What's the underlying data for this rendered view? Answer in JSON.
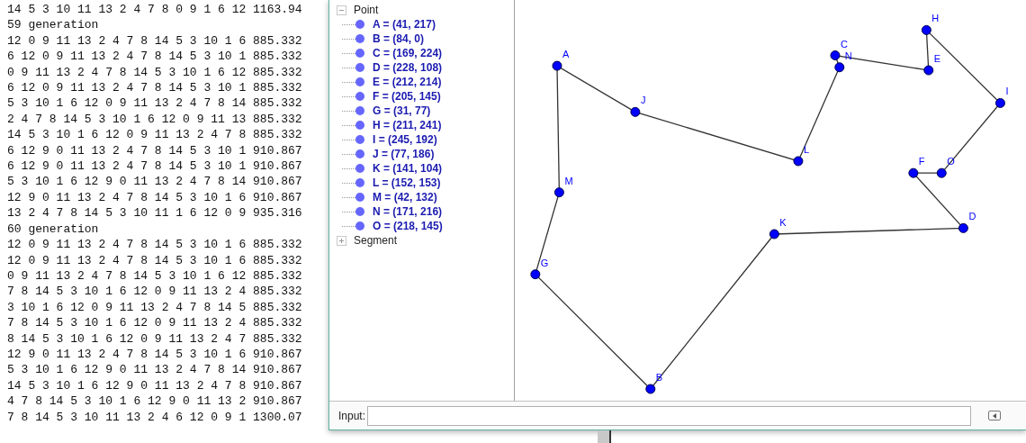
{
  "console": {
    "lines": [
      "14 5 3 10 11 13 2 4 7 8 0 9 1 6 12 1163.94",
      "59 generation",
      "12 0 9 11 13 2 4 7 8 14 5 3 10 1 6 885.332",
      "6 12 0 9 11 13 2 4 7 8 14 5 3 10 1 885.332",
      "0 9 11 13 2 4 7 8 14 5 3 10 1 6 12 885.332",
      "6 12 0 9 11 13 2 4 7 8 14 5 3 10 1 885.332",
      "5 3 10 1 6 12 0 9 11 13 2 4 7 8 14 885.332",
      "2 4 7 8 14 5 3 10 1 6 12 0 9 11 13 885.332",
      "14 5 3 10 1 6 12 0 9 11 13 2 4 7 8 885.332",
      "6 12 9 0 11 13 2 4 7 8 14 5 3 10 1 910.867",
      "6 12 9 0 11 13 2 4 7 8 14 5 3 10 1 910.867",
      "5 3 10 1 6 12 9 0 11 13 2 4 7 8 14 910.867",
      "12 9 0 11 13 2 4 7 8 14 5 3 10 1 6 910.867",
      "13 2 4 7 8 14 5 3 10 11 1 6 12 0 9 935.316",
      "60 generation",
      "12 0 9 11 13 2 4 7 8 14 5 3 10 1 6 885.332",
      "12 0 9 11 13 2 4 7 8 14 5 3 10 1 6 885.332",
      "0 9 11 13 2 4 7 8 14 5 3 10 1 6 12 885.332",
      "7 8 14 5 3 10 1 6 12 0 9 11 13 2 4 885.332",
      "3 10 1 6 12 0 9 11 13 2 4 7 8 14 5 885.332",
      "7 8 14 5 3 10 1 6 12 0 9 11 13 2 4 885.332",
      "8 14 5 3 10 1 6 12 0 9 11 13 2 4 7 885.332",
      "12 9 0 11 13 2 4 7 8 14 5 3 10 1 6 910.867",
      "5 3 10 1 6 12 9 0 11 13 2 4 7 8 14 910.867",
      "14 5 3 10 1 6 12 9 0 11 13 2 4 7 8 910.867",
      "4 7 8 14 5 3 10 1 6 12 9 0 11 13 2 910.867",
      "7 8 14 5 3 10 11 13 2 4 6 12 0 9 1 1300.07"
    ]
  },
  "algebra_view": {
    "categories": [
      {
        "label": "Point",
        "expanded": true,
        "items": [
          {
            "label": "A = (41, 217)",
            "canvas_label": "A"
          },
          {
            "label": "B = (84, 0)",
            "canvas_label": "B"
          },
          {
            "label": "C = (169, 224)",
            "canvas_label": "C"
          },
          {
            "label": "D = (228, 108)",
            "canvas_label": "D"
          },
          {
            "label": "E = (212, 214)",
            "canvas_label": "E"
          },
          {
            "label": "F = (205, 145)",
            "canvas_label": "F"
          },
          {
            "label": "G = (31, 77)",
            "canvas_label": "G"
          },
          {
            "label": "H = (211, 241)",
            "canvas_label": "H"
          },
          {
            "label": "I = (245, 192)",
            "canvas_label": "I"
          },
          {
            "label": "J = (77, 186)",
            "canvas_label": "J"
          },
          {
            "label": "K = (141, 104)",
            "canvas_label": "K"
          },
          {
            "label": "L = (152, 153)",
            "canvas_label": "L"
          },
          {
            "label": "M = (42, 132)",
            "canvas_label": "M"
          },
          {
            "label": "N = (171, 216)",
            "canvas_label": "N"
          },
          {
            "label": "O = (218, 145)",
            "canvas_label": "O"
          }
        ]
      },
      {
        "label": "Segment",
        "expanded": false
      }
    ]
  },
  "input_bar": {
    "label": "Input:"
  }
}
